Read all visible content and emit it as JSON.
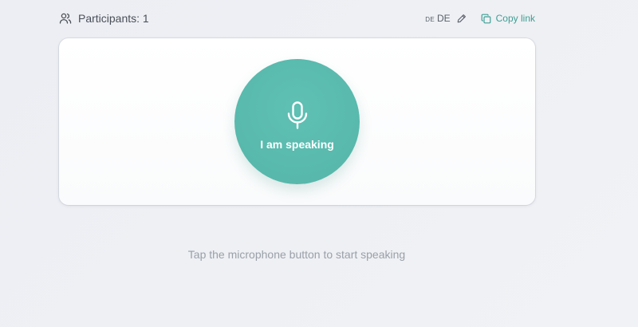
{
  "header": {
    "participants_label": "Participants: 1",
    "language_code": "DE",
    "language_name": "DE",
    "copy_link_label": "Copy link"
  },
  "main": {
    "mic_button_label": "I am speaking"
  },
  "footer": {
    "hint": "Tap the microphone button to start speaking"
  },
  "icons": {
    "participants": "users-icon",
    "edit": "pencil-icon",
    "copy": "copy-icon",
    "mic": "microphone-icon"
  },
  "colors": {
    "accent": "#3f9e93",
    "mic_button": "#5bbcb0",
    "background": "#eef0f4"
  }
}
